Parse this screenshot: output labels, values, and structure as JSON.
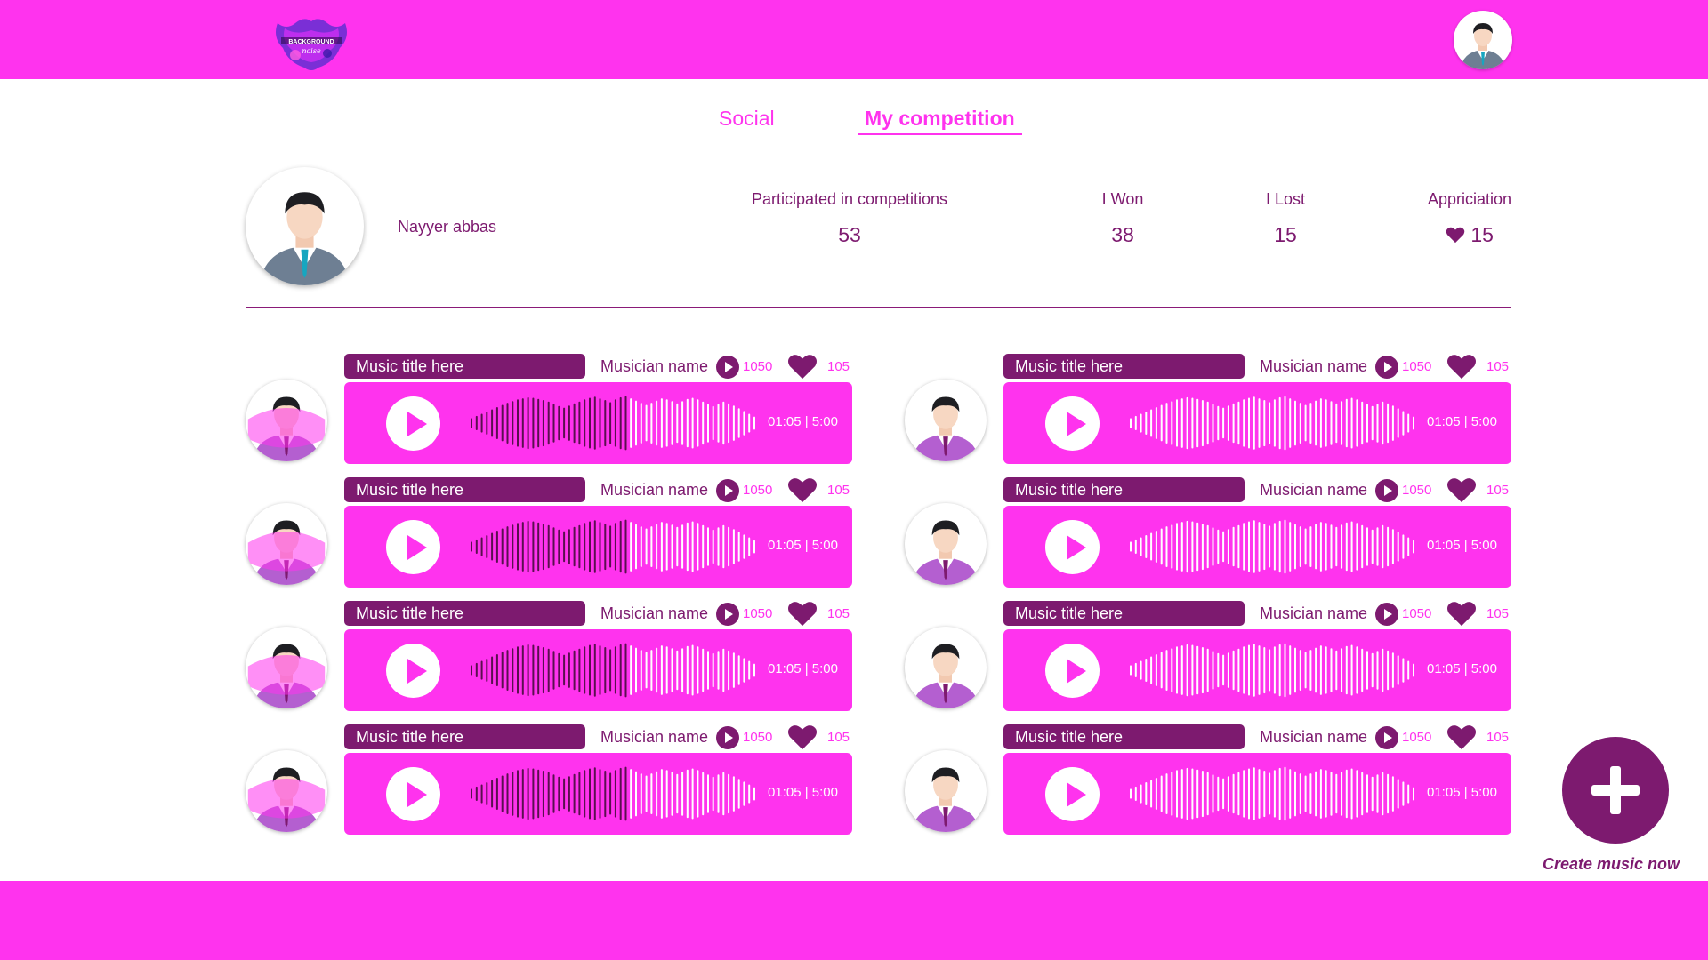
{
  "colors": {
    "accent": "#ff33ee",
    "dark": "#7d1a6f",
    "white": "#ffffff"
  },
  "header": {
    "logo_icon": "background-noise-logo",
    "avatar_icon": "user-avatar-icon"
  },
  "tabs": [
    {
      "label": "Social",
      "active": false
    },
    {
      "label": "My competition",
      "active": true
    }
  ],
  "profile": {
    "name": "Nayyer abbas",
    "avatar_icon": "user-avatar-icon"
  },
  "stats": [
    {
      "label": "Participated in competitions",
      "value": "53"
    },
    {
      "label": "I Won",
      "value": "38"
    },
    {
      "label": "I Lost",
      "value": "15"
    },
    {
      "label": "Appriciation",
      "value": "15",
      "icon": "heart-icon"
    }
  ],
  "tracks": [
    {
      "title": "Music title here",
      "musician": "Musician name",
      "plays": "1050",
      "likes": "105",
      "time": "01:05 | 5:00",
      "progress": 0.55
    },
    {
      "title": "Music title here",
      "musician": "Musician name",
      "plays": "1050",
      "likes": "105",
      "time": "01:05 | 5:00",
      "progress": 0.0
    },
    {
      "title": "Music title here",
      "musician": "Musician name",
      "plays": "1050",
      "likes": "105",
      "time": "01:05 | 5:00",
      "progress": 0.55
    },
    {
      "title": "Music title here",
      "musician": "Musician name",
      "plays": "1050",
      "likes": "105",
      "time": "01:05 | 5:00",
      "progress": 0.0
    },
    {
      "title": "Music title here",
      "musician": "Musician name",
      "plays": "1050",
      "likes": "105",
      "time": "01:05 | 5:00",
      "progress": 0.55
    },
    {
      "title": "Music title here",
      "musician": "Musician name",
      "plays": "1050",
      "likes": "105",
      "time": "01:05 | 5:00",
      "progress": 0.0
    },
    {
      "title": "Music title here",
      "musician": "Musician name",
      "plays": "1050",
      "likes": "105",
      "time": "01:05 | 5:00",
      "progress": 0.55
    },
    {
      "title": "Music title here",
      "musician": "Musician name",
      "plays": "1050",
      "likes": "105",
      "time": "01:05 | 5:00",
      "progress": 0.0
    }
  ],
  "create": {
    "label": "Create music now",
    "icon": "plus-icon"
  }
}
